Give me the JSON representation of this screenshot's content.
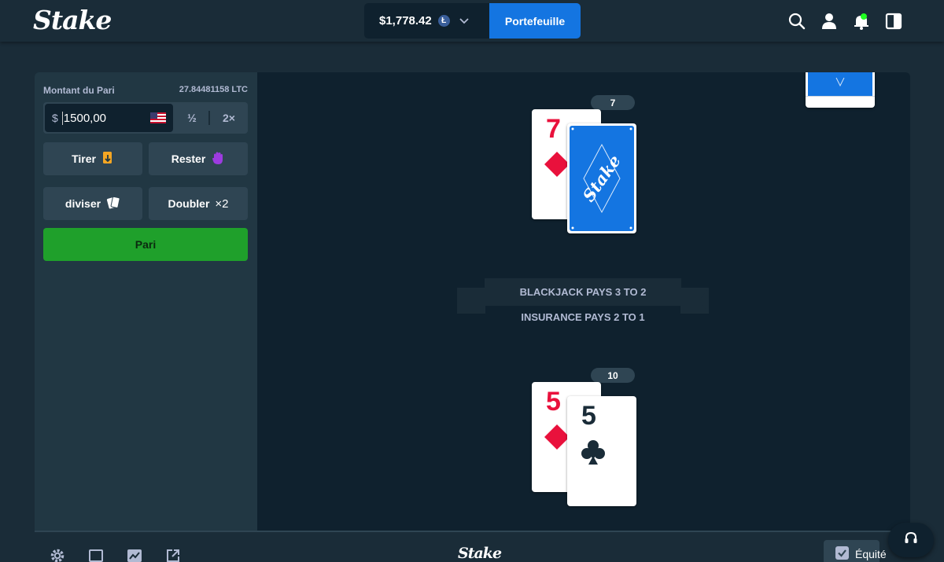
{
  "header": {
    "logo_text": "Stake",
    "balance": "$1,778.42",
    "currency_symbol": "Ł",
    "wallet_label": "Portefeuille"
  },
  "sidebar": {
    "bet_amount_label": "Montant du Pari",
    "bet_amount_crypto": "27.84481158 LTC",
    "currency_prefix": "$",
    "bet_value": "1500,00",
    "half_label": "½",
    "double_label": "2×",
    "hit_label": "Tirer",
    "stand_label": "Rester",
    "split_label": "diviser",
    "double_down_label": "Doubler",
    "double_down_badge": "×2",
    "bet_button_label": "Pari"
  },
  "board": {
    "dealer": {
      "score": "7",
      "up_card": {
        "rank": "7",
        "suit": "diamonds",
        "color": "#e9113c"
      },
      "back_card_logo": "Stake"
    },
    "player": {
      "score": "10",
      "cards": [
        {
          "rank": "5",
          "suit": "diamonds",
          "color": "#e9113c"
        },
        {
          "rank": "5",
          "suit": "clubs",
          "color": "#1a2c38"
        }
      ]
    },
    "banner_text": "BLACKJACK PAYS 3 TO 2",
    "insurance_text": "INSURANCE PAYS 2 TO 1"
  },
  "footer": {
    "logo_text": "Stake",
    "fairness_label": "Équité"
  },
  "colors": {
    "accent_blue": "#1475e1",
    "bet_green": "#1fa02b",
    "background": "#1a2c38",
    "panel": "#213743",
    "board": "#0f212e",
    "suit_red": "#e9113c"
  }
}
